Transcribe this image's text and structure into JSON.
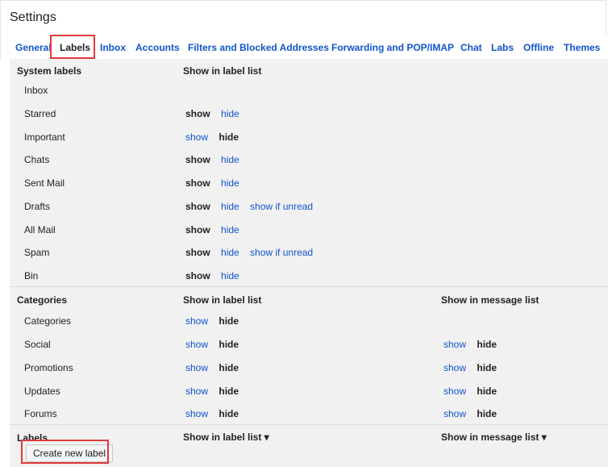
{
  "header": {
    "title": "Settings"
  },
  "tabs": [
    {
      "label": "General",
      "active": false
    },
    {
      "label": "Labels",
      "active": true
    },
    {
      "label": "Inbox",
      "active": false
    },
    {
      "label": "Accounts",
      "active": false
    },
    {
      "label": "Filters and Blocked Addresses",
      "active": false
    },
    {
      "label": "Forwarding and POP/IMAP",
      "active": false
    },
    {
      "label": "Chat",
      "active": false
    },
    {
      "label": "Labs",
      "active": false
    },
    {
      "label": "Offline",
      "active": false
    },
    {
      "label": "Themes",
      "active": false
    }
  ],
  "system_labels": {
    "header": "System labels",
    "col_label_list": "Show in label list",
    "rows": [
      {
        "name": "Inbox"
      },
      {
        "name": "Starred",
        "show": "show",
        "hide": "hide",
        "selected": "show"
      },
      {
        "name": "Important",
        "show": "show",
        "hide": "hide",
        "selected": "hide"
      },
      {
        "name": "Chats",
        "show": "show",
        "hide": "hide",
        "selected": "show"
      },
      {
        "name": "Sent Mail",
        "show": "show",
        "hide": "hide",
        "selected": "show"
      },
      {
        "name": "Drafts",
        "show": "show",
        "hide": "hide",
        "unread": "show if unread",
        "selected": "show"
      },
      {
        "name": "All Mail",
        "show": "show",
        "hide": "hide",
        "selected": "show"
      },
      {
        "name": "Spam",
        "show": "show",
        "hide": "hide",
        "unread": "show if unread",
        "selected": "show"
      },
      {
        "name": "Bin",
        "show": "show",
        "hide": "hide",
        "selected": "show"
      }
    ]
  },
  "categories": {
    "header": "Categories",
    "col_label_list": "Show in label list",
    "col_message_list": "Show in message list",
    "rows": [
      {
        "name": "Categories",
        "show": "show",
        "hide": "hide"
      },
      {
        "name": "Social",
        "show": "show",
        "hide": "hide",
        "msg_show": "show",
        "msg_hide": "hide"
      },
      {
        "name": "Promotions",
        "show": "show",
        "hide": "hide",
        "msg_show": "show",
        "msg_hide": "hide"
      },
      {
        "name": "Updates",
        "show": "show",
        "hide": "hide",
        "msg_show": "show",
        "msg_hide": "hide"
      },
      {
        "name": "Forums",
        "show": "show",
        "hide": "hide",
        "msg_show": "show",
        "msg_hide": "hide"
      }
    ]
  },
  "labels": {
    "header": "Labels",
    "col_label_list": "Show in label list ▾",
    "col_message_list": "Show in message list ▾",
    "create_button": "Create new label"
  }
}
